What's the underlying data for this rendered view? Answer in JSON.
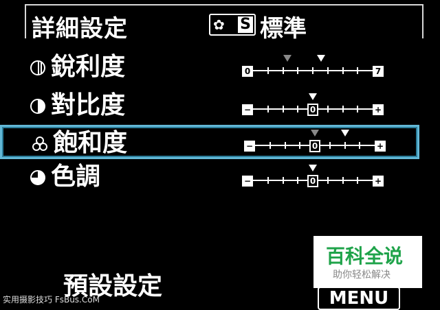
{
  "header": {
    "title": "詳細設定",
    "style_icon_letter": "S",
    "style_name": "標準"
  },
  "rows": [
    {
      "label": "銳利度",
      "icon": "sharpness-icon",
      "scale_left": "0",
      "scale_right": "7",
      "value": 4,
      "default": 2,
      "min": 0,
      "max": 7
    },
    {
      "label": "對比度",
      "icon": "contrast-icon",
      "scale_left": "−",
      "scale_center": "0",
      "scale_right": "+",
      "value": 0,
      "default": 0,
      "min": -4,
      "max": 4
    },
    {
      "label": "飽和度",
      "icon": "saturation-icon",
      "scale_left": "−",
      "scale_center": "0",
      "scale_right": "+",
      "value": 2,
      "default": 0,
      "min": -4,
      "max": 4
    },
    {
      "label": "色調",
      "icon": "color-tone-icon",
      "scale_left": "−",
      "scale_center": "0",
      "scale_right": "+",
      "value": 0,
      "default": 0,
      "min": -4,
      "max": 4
    }
  ],
  "selected_row": 2,
  "preset_label": "預設設定",
  "menu_label": "MENU",
  "watermark": {
    "left": "实用摄影技巧 FsBus.CoM",
    "brand_title": "百科全说",
    "brand_sub": "助你轻松解决"
  }
}
